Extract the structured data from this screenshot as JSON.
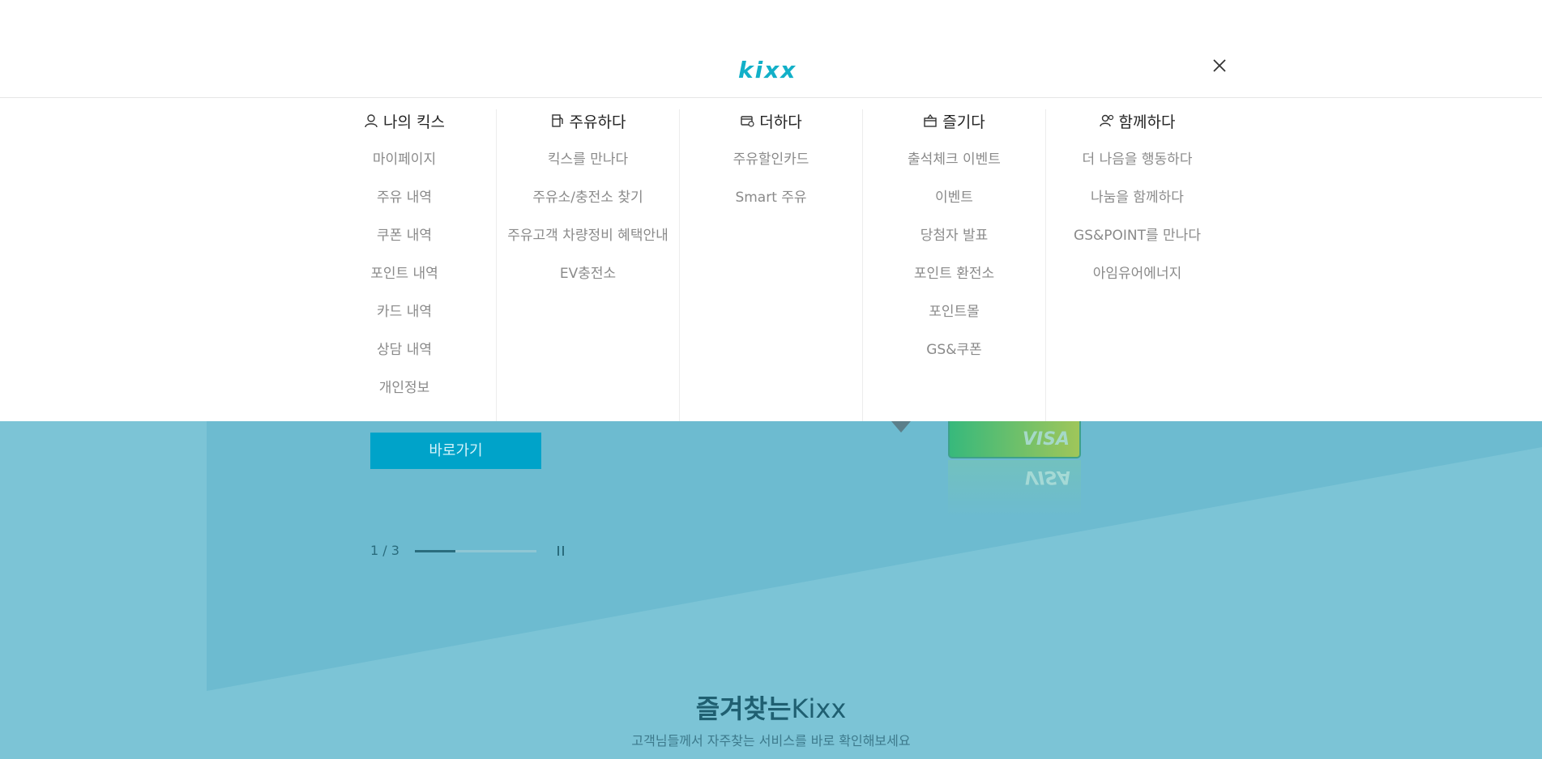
{
  "header": {
    "logo_text": "kixx",
    "accent_color": "#12b0c8"
  },
  "menu": {
    "columns": [
      {
        "title": "나의 킥스",
        "icon": "user-icon",
        "items": [
          "마이페이지",
          "주유 내역",
          "쿠폰 내역",
          "포인트 내역",
          "카드 내역",
          "상담 내역",
          "개인정보"
        ]
      },
      {
        "title": "주유하다",
        "icon": "fuel-pump-icon",
        "items": [
          "킥스를 만나다",
          "주유소/충전소 찾기",
          "주유고객 차량정비 혜택안내",
          "EV충전소"
        ]
      },
      {
        "title": "더하다",
        "icon": "wallet-plus-icon",
        "items": [
          "주유할인카드",
          "Smart 주유"
        ]
      },
      {
        "title": "즐기다",
        "icon": "gift-box-icon",
        "items": [
          "출석체크 이벤트",
          "이벤트",
          "당첨자 발표",
          "포인트 환전소",
          "포인트몰",
          "GS&쿠폰"
        ]
      },
      {
        "title": "함께하다",
        "icon": "people-icon",
        "items": [
          "더 나음을 행동하다",
          "나눔을 함께하다",
          "GS&POINT를 만나다",
          "아임유어에너지"
        ]
      }
    ]
  },
  "hero": {
    "button_label": "바로가기",
    "pager_text": "1 / 3",
    "progress_fraction": 0.33,
    "card_brand": "VISA",
    "background_color": "#7cc4d6"
  },
  "favorites": {
    "title_bold": "즐겨찾는",
    "title_regular": "Kixx",
    "subtitle": "고객님들께서 자주찾는 서비스를 바로 확인해보세요"
  }
}
